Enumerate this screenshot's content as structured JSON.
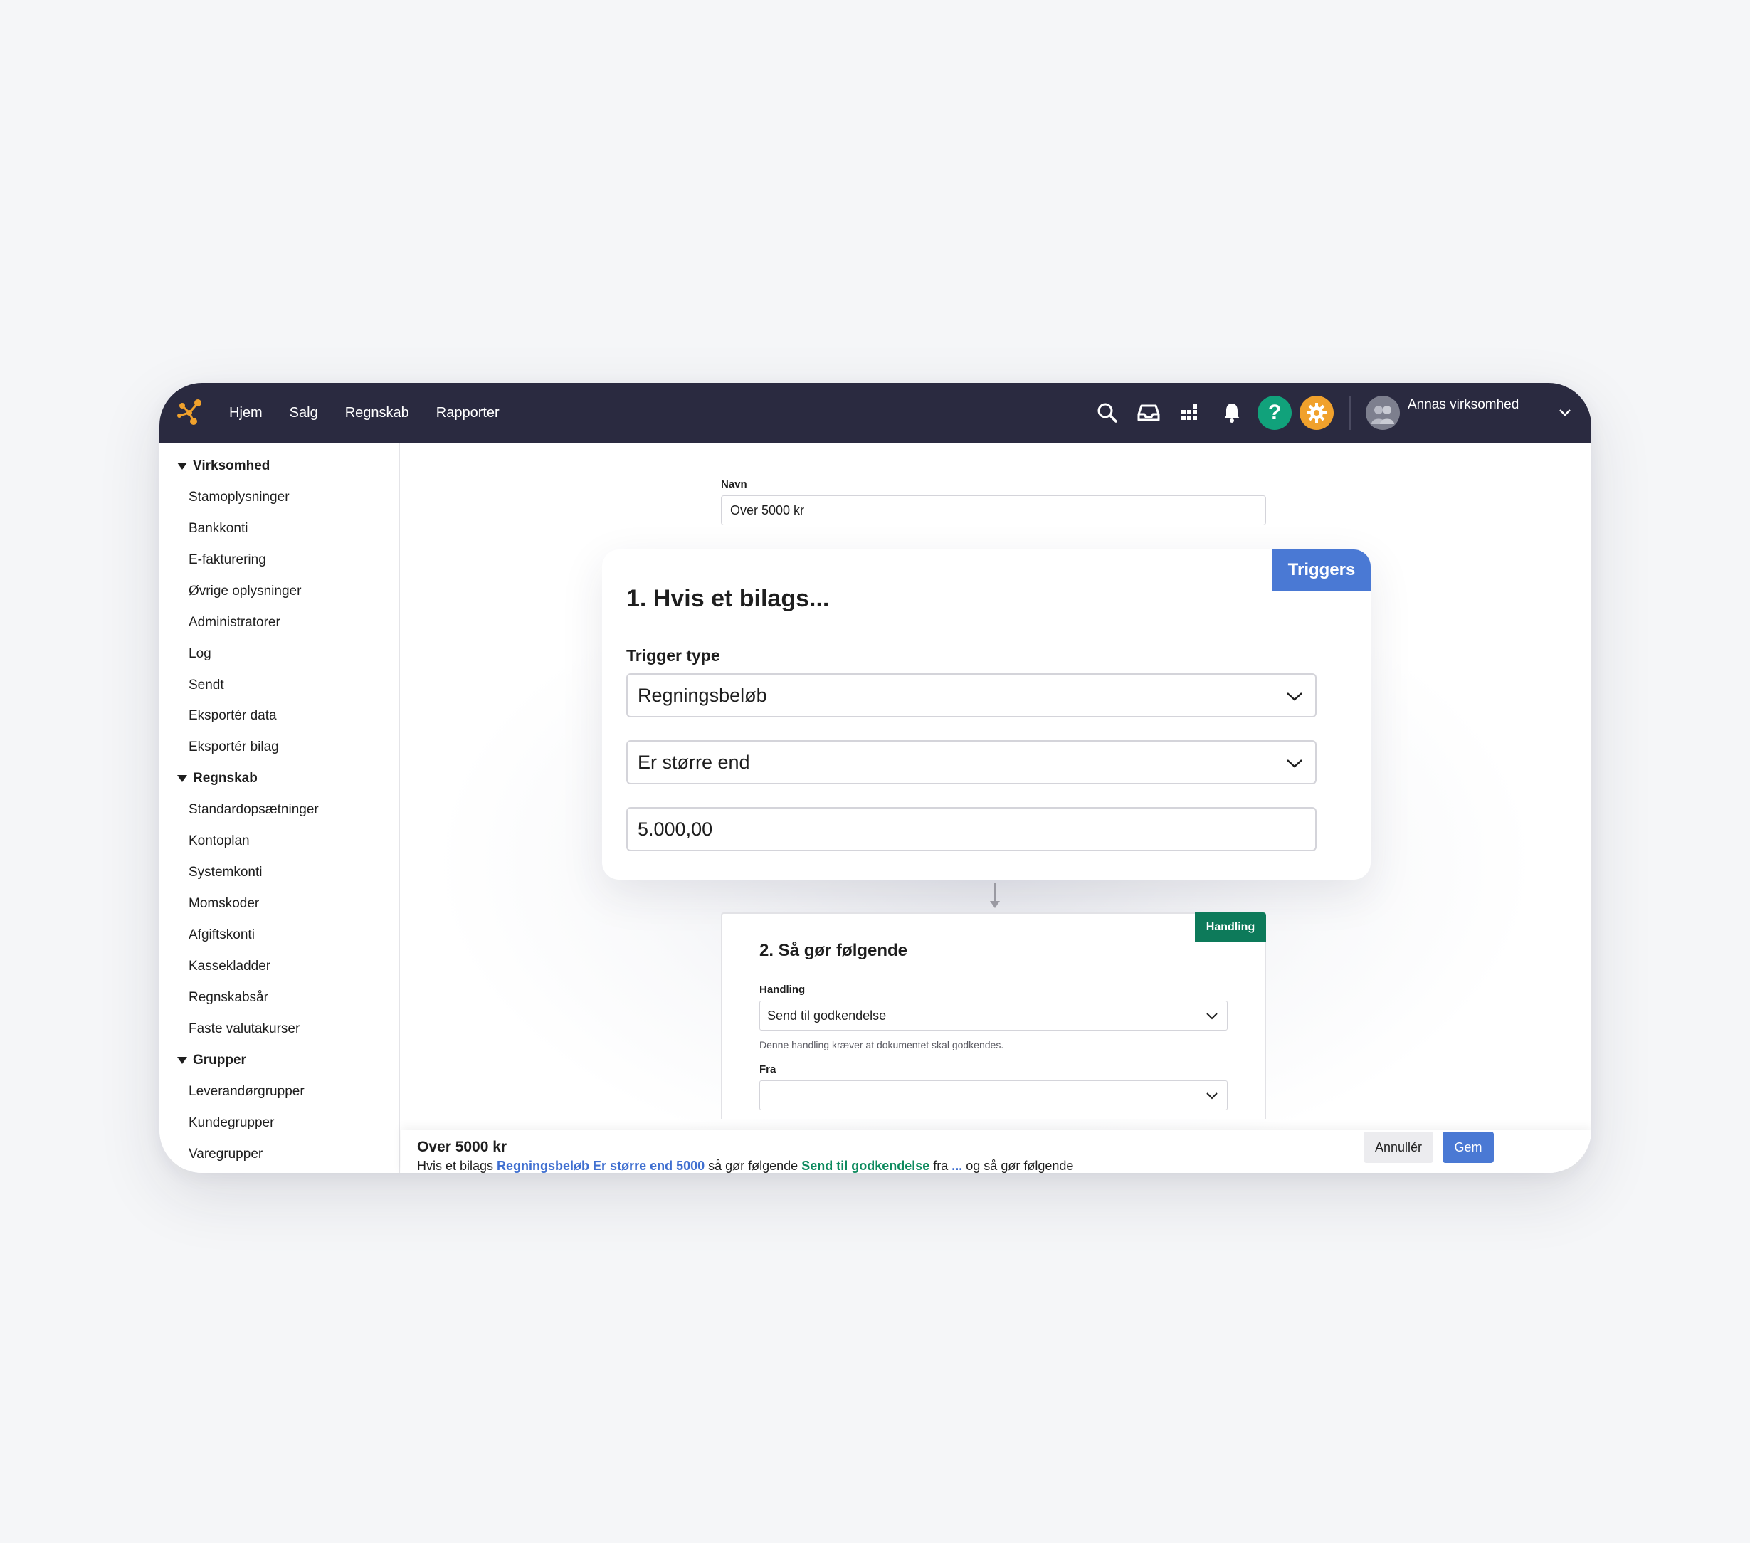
{
  "nav": [
    "Hjem",
    "Salg",
    "Regnskab",
    "Rapporter"
  ],
  "topbar": {
    "icons": [
      "search-icon",
      "inbox-icon",
      "apps-grid-icon",
      "bell-icon",
      "help-icon",
      "settings-icon"
    ],
    "help_glyph": "?",
    "company": "Annas virksomhed",
    "colors": {
      "bar": "#2a2a40",
      "help": "#11a27b",
      "settings": "#f0a12c",
      "logo": "#f0a12c"
    }
  },
  "sidebar": {
    "sections": [
      {
        "title": "Virksomhed",
        "items": [
          "Stamoplysninger",
          "Bankkonti",
          "E-fakturering",
          "Øvrige oplysninger",
          "Administratorer",
          "Log",
          "Sendt",
          "Eksportér data",
          "Eksportér bilag"
        ]
      },
      {
        "title": "Regnskab",
        "items": [
          "Standardopsætninger",
          "Kontoplan",
          "Systemkonti",
          "Momskoder",
          "Afgiftskonti",
          "Kassekladder",
          "Regnskabsår",
          "Faste valutakurser"
        ]
      },
      {
        "title": "Grupper",
        "items": [
          "Leverandørgrupper",
          "Kundegrupper",
          "Varegrupper"
        ]
      }
    ]
  },
  "form": {
    "name_label": "Navn",
    "name_value": "Over 5000 kr"
  },
  "trigger": {
    "badge": "Triggers",
    "title": "1. Hvis et bilags...",
    "type_label": "Trigger type",
    "type_value": "Regningsbeløb",
    "operator_value": "Er større end",
    "amount_value": "5.000,00",
    "badge_color": "#4a79d4"
  },
  "action": {
    "badge": "Handling",
    "title": "2. Så gør følgende",
    "handling_label": "Handling",
    "handling_value": "Send til godkendelse",
    "hint": "Denne handling kræver at dokumentet skal godkendes.",
    "fra_label": "Fra",
    "fra_value": "",
    "badge_color": "#0d7a5a"
  },
  "summary": {
    "title": "Over 5000 kr",
    "p1": "Hvis et bilags ",
    "trigger_text": "Regningsbeløb Er større end 5000",
    "p2": " så gør følgende ",
    "action_text": "Send til godkendelse",
    "p3": " fra ",
    "ellipsis": "...",
    "p4": " og så gør følgende",
    "cancel": "Annullér",
    "save": "Gem"
  }
}
